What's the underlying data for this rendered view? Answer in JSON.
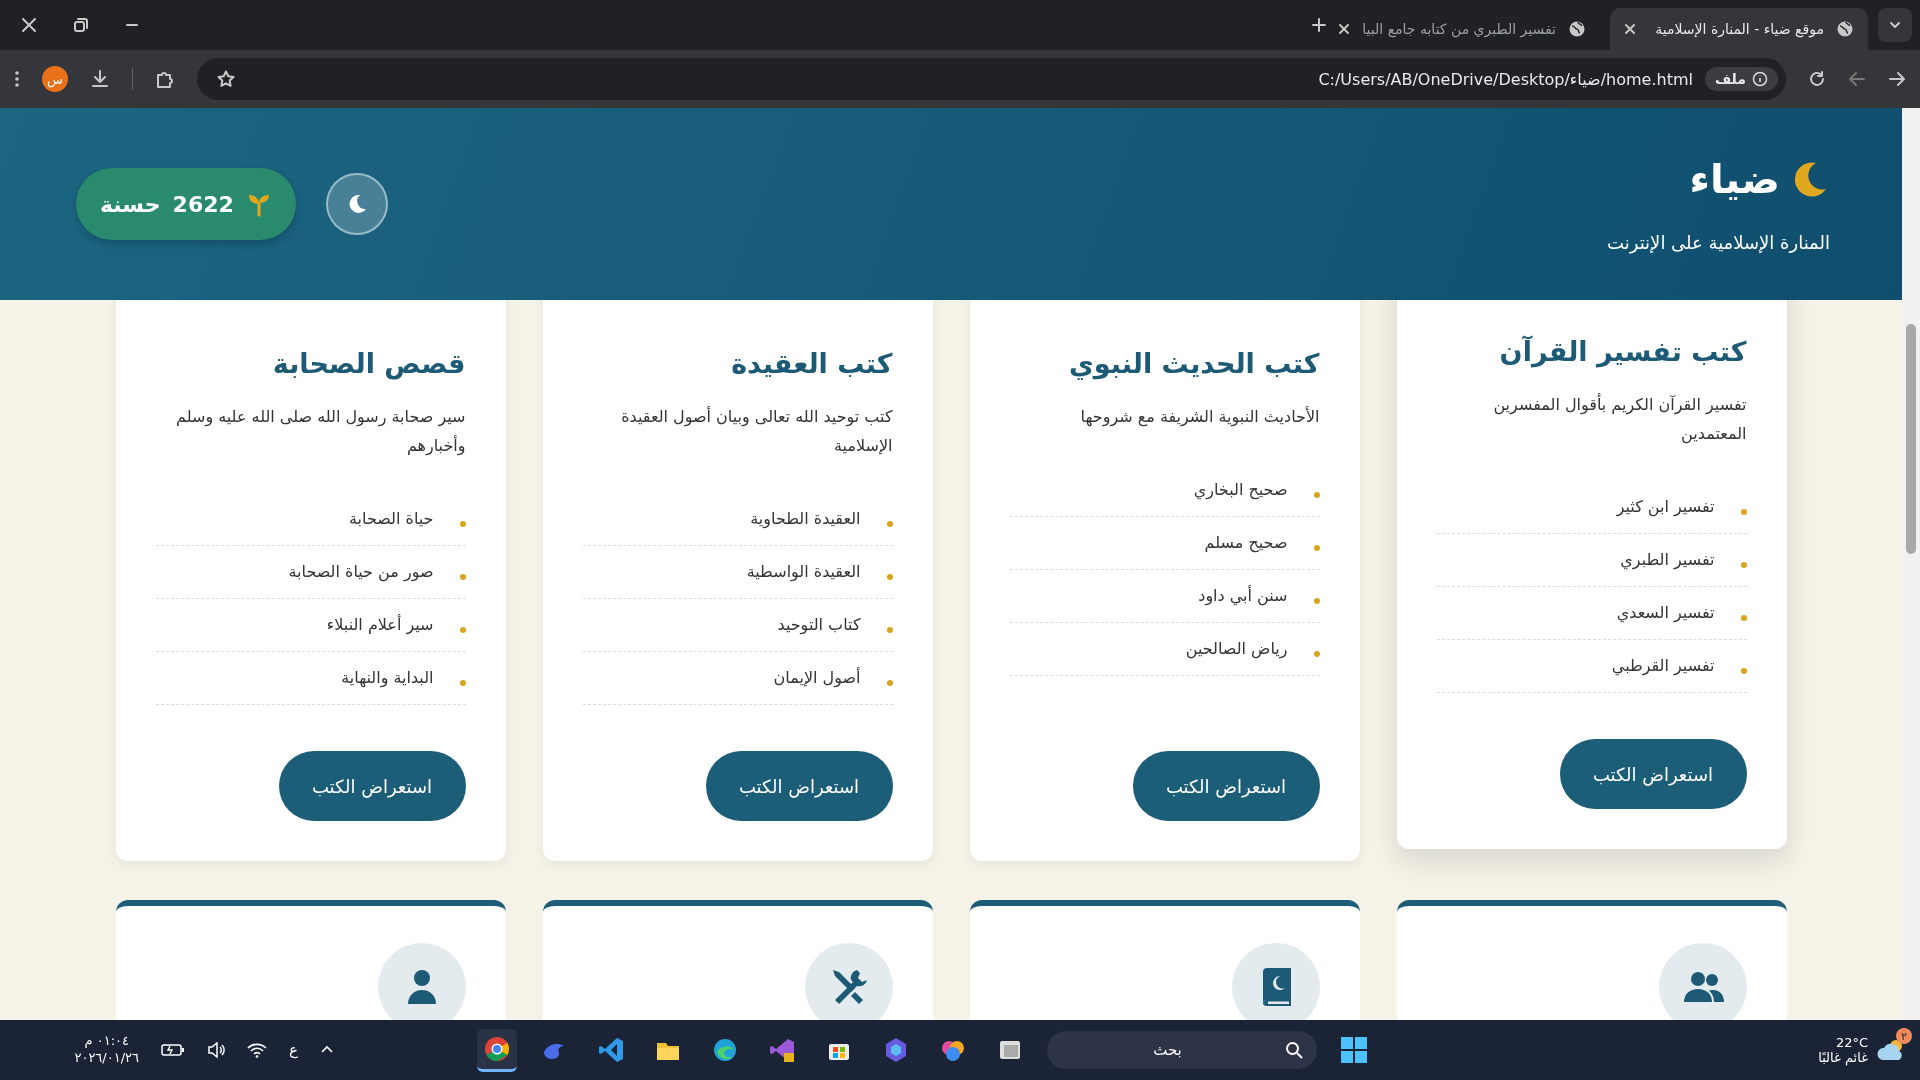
{
  "browser": {
    "tabs": [
      {
        "title": "موقع ضياء - المنارة الإسلامية",
        "selected": true
      },
      {
        "title": "تفسير الطبري من كتابه جامع البيا",
        "selected": false
      }
    ],
    "address": {
      "chip": "ملف",
      "url": "C:/Users/AB/OneDrive/Desktop/ضياء/home.html"
    },
    "profile": "س"
  },
  "header": {
    "logo": "ضياء",
    "tagline": "المنارة الإسلامية على الإنترنت",
    "points": "2622",
    "points_label": "حسنة"
  },
  "categories": [
    {
      "title": "كتب تفسير القرآن",
      "description": "تفسير القرآن الكريم بأقوال المفسرين المعتمدين",
      "hovered": true,
      "books": [
        "تفسير ابن كثير",
        "تفسير الطبري",
        "تفسير السعدي",
        "تفسير القرطبي"
      ],
      "button": "استعراض الكتب"
    },
    {
      "title": "كتب الحديث النبوي",
      "description": "الأحاديث النبوية الشريفة مع شروحها",
      "hovered": false,
      "books": [
        "صحيح البخاري",
        "صحيح مسلم",
        "سنن أبي داود",
        "رياض الصالحين"
      ],
      "button": "استعراض الكتب"
    },
    {
      "title": "كتب العقيدة",
      "description": "كتب توحيد الله تعالى وبيان أصول العقيدة الإسلامية",
      "hovered": false,
      "books": [
        "العقيدة الطحاوية",
        "العقيدة الواسطية",
        "كتاب التوحيد",
        "أصول الإيمان"
      ],
      "button": "استعراض الكتب"
    },
    {
      "title": "قصص الصحابة",
      "description": "سير صحابة رسول الله صلى الله عليه وسلم وأخبارهم",
      "hovered": false,
      "books": [
        "حياة الصحابة",
        "صور من حياة الصحابة",
        "سير أعلام النبلاء",
        "البداية والنهاية"
      ],
      "button": "استعراض الكتب"
    }
  ],
  "next_cards": [
    {
      "kind": "people"
    },
    {
      "kind": "book"
    },
    {
      "kind": "tools"
    },
    {
      "kind": "person"
    }
  ],
  "taskbar": {
    "weather_badge": "٢",
    "temperature": "22°C",
    "weather": "غائم غالبًا",
    "search_placeholder": "بحث",
    "language": "ع",
    "time": "٠١:٠٤ م",
    "date": "٢٠٢٦/٠١/٢٦"
  }
}
